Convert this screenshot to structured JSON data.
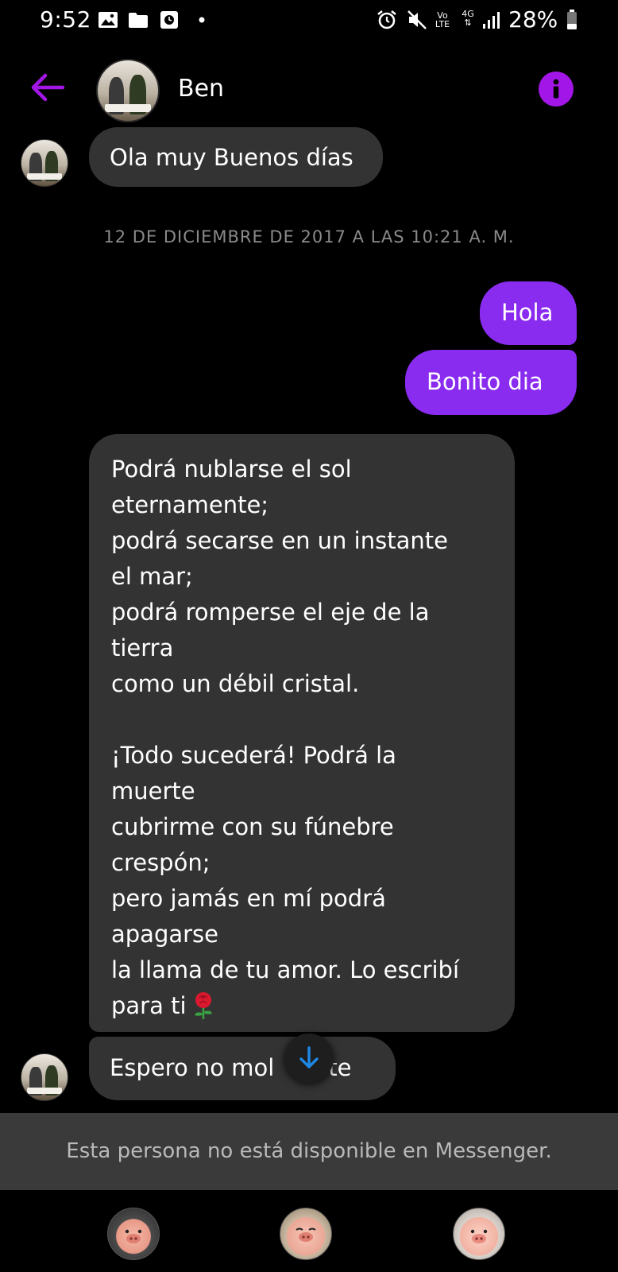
{
  "status_bar": {
    "time": "9:52",
    "volte_top": "Vo",
    "volte_bottom": "LTE",
    "network": "4G",
    "battery": "28%"
  },
  "header": {
    "contact_name": "Ben"
  },
  "messages": {
    "greeting": "Ola muy Buenos días",
    "timestamp": "12 DE DICIEMBRE DE 2017 A LAS 10:21 A. M.",
    "out_1": "Hola",
    "out_2": "Bonito dia",
    "poem": "Podrá nublarse el sol\neternamente;\npodrá secarse en un instante\nel mar;\npodrá romperse el eje de la\ntierra\ncomo un débil cristal.\n\n¡Todo sucederá! Podrá la\nmuerte\ncubrirme con su fúnebre\ncrespón;\npero jamás en mí podrá\napagarse\nla llama de tu amor. Lo escribí\npara ti",
    "last_visible_left": "Espero no mol",
    "last_visible_right": "rte"
  },
  "banner": {
    "unavailable_text": "Esta persona no está disponible en Messenger."
  },
  "colors": {
    "accent": "#a316e8",
    "outgoing_bubble": "#8a2bf0",
    "incoming_bubble": "#333333",
    "scroll_arrow": "#1e88e5"
  },
  "icons": {
    "back": "arrow-left-icon",
    "info": "info-icon",
    "scroll_down": "arrow-down-icon",
    "emoji": "rose-icon"
  }
}
